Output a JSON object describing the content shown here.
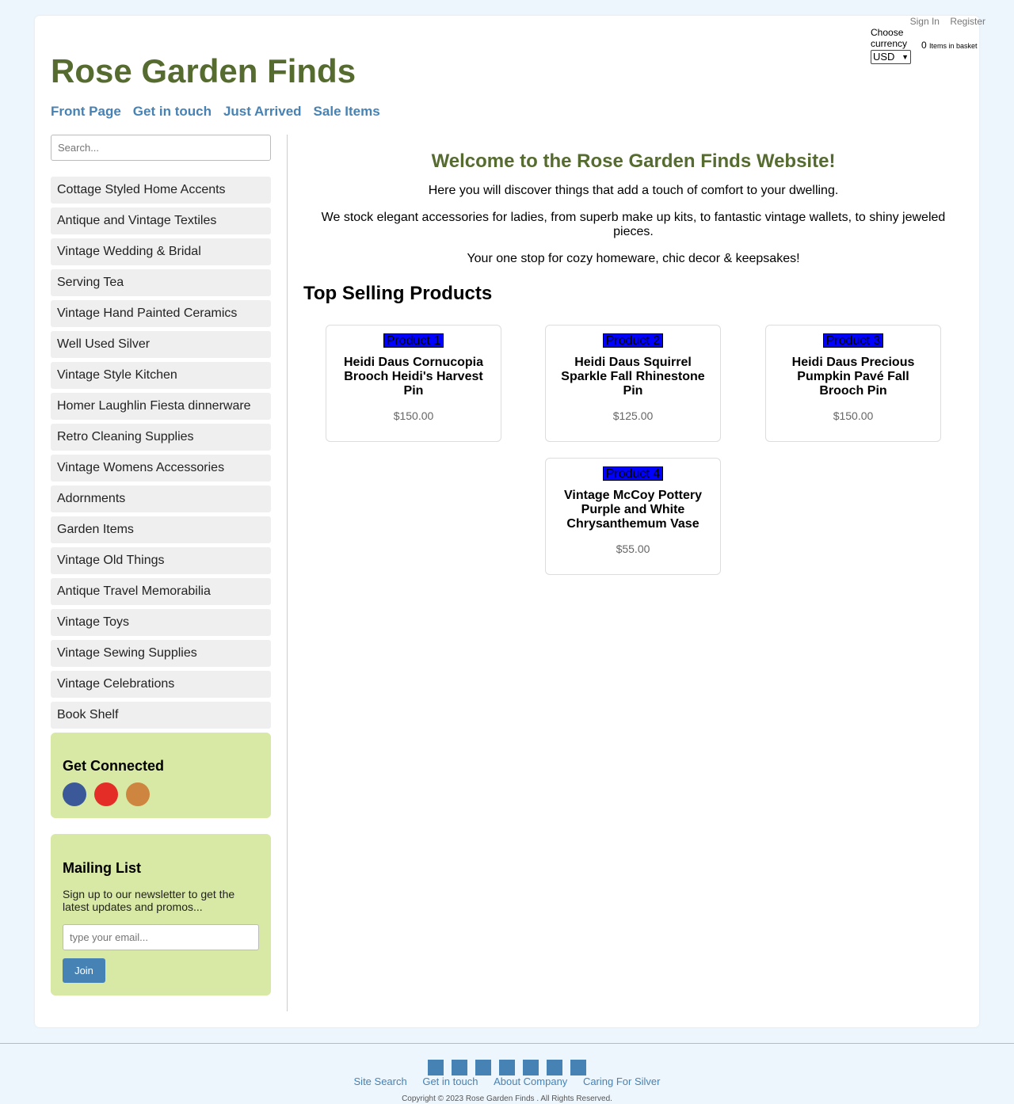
{
  "header": {
    "account_links": [
      "Sign In",
      "Register"
    ],
    "currency_label": "Choose currency",
    "currency_value": "USD",
    "basket_count": "0",
    "basket_label": "Items in basket",
    "logo": "Rose Garden Finds",
    "nav": [
      "Front Page",
      "Get in touch",
      "Just Arrived",
      "Sale Items"
    ]
  },
  "sidebar": {
    "search_placeholder": "Search...",
    "categories": [
      "Cottage Styled Home Accents",
      "Antique and Vintage Textiles",
      "Vintage Wedding & Bridal",
      "Serving Tea",
      "Vintage Hand Painted Ceramics",
      "Well Used Silver",
      "Vintage Style Kitchen",
      "Homer Laughlin Fiesta dinnerware",
      "Retro Cleaning Supplies",
      "Vintage Womens Accessories",
      "Adornments",
      "Garden Items",
      "Vintage Old Things",
      "Antique Travel Memorabilia",
      "Vintage Toys",
      "Vintage Sewing Supplies",
      "Vintage Celebrations",
      "Book Shelf"
    ],
    "connect_title": "Get Connected",
    "social_colors": [
      "#3b5998",
      "#e52d27",
      "#cd853f"
    ],
    "mailing_title": "Mailing List",
    "mailing_text": "Sign up to our newsletter to get the latest updates and promos...",
    "email_placeholder": "type your email...",
    "join_label": "Join"
  },
  "main": {
    "welcome_title": "Welcome to the Rose Garden Finds Website!",
    "intro": [
      "Here you will discover things that add a touch of comfort to your dwelling.",
      "We stock elegant accessories for ladies, from superb make up kits, to fantastic vintage wallets, to shiny jeweled pieces.",
      "Your one stop for cozy homeware, chic decor & keepsakes!"
    ],
    "top_title": "Top Selling Products",
    "products": [
      {
        "img_alt": "Product 1",
        "title": "Heidi Daus Cornucopia Brooch Heidi's Harvest Pin",
        "price": "$150.00"
      },
      {
        "img_alt": "Product 2",
        "title": "Heidi Daus Squirrel Sparkle Fall Rhinestone Pin",
        "price": "$125.00"
      },
      {
        "img_alt": "Product 3",
        "title": "Heidi Daus Precious Pumpkin Pavé Fall Brooch Pin",
        "price": "$150.00"
      },
      {
        "img_alt": "Product 4",
        "title": "Vintage McCoy Pottery Purple and White Chrysanthemum Vase",
        "price": "$55.00"
      }
    ]
  },
  "footer": {
    "links": [
      "Site Search",
      "Get in touch",
      "About Company",
      "Caring For Silver"
    ],
    "copyright": "Copyright © 2023 Rose Garden Finds . All Rights Reserved."
  },
  "colors": {
    "brand": "#556b2f",
    "link": "#4682b4",
    "box_bg": "#d8e8a5",
    "page_bg": "#eef6fd"
  }
}
